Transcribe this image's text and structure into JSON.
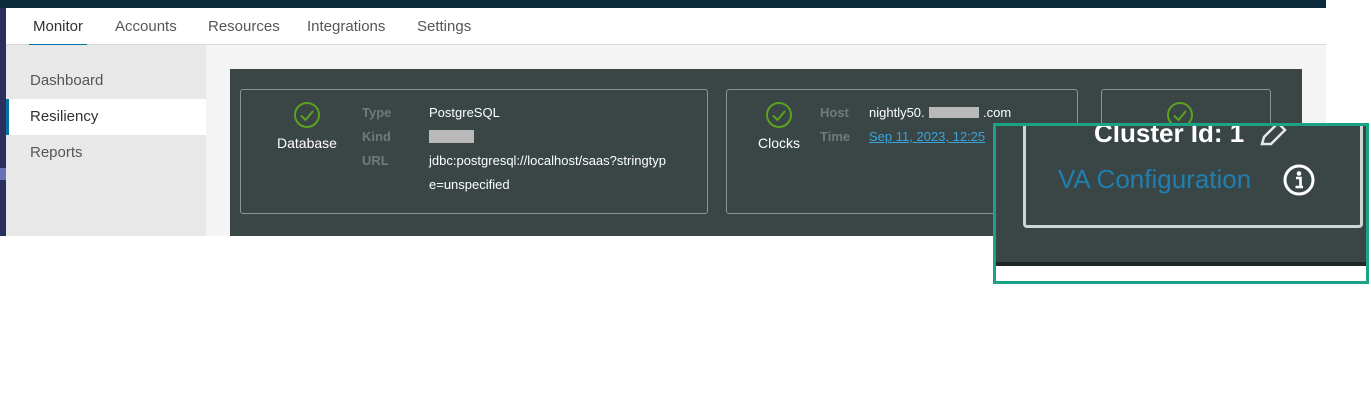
{
  "nav": {
    "tabs": [
      "Monitor",
      "Accounts",
      "Resources",
      "Integrations",
      "Settings"
    ],
    "active": "Monitor"
  },
  "sidebar": {
    "items": [
      "Dashboard",
      "Resiliency",
      "Reports"
    ],
    "active": "Resiliency"
  },
  "cards": {
    "database": {
      "name": "Database",
      "status_icon": "check-circle-icon",
      "type_label": "Type",
      "type_value": "PostgreSQL",
      "kind_label": "Kind",
      "kind_value_redacted": true,
      "url_label": "URL",
      "url_value_line1": "jdbc:postgresql://localhost/saas?stringtyp",
      "url_value_line2": "e=unspecified"
    },
    "clocks": {
      "name": "Clocks",
      "status_icon": "check-circle-icon",
      "host_label": "Host",
      "host_value_prefix": "nightly50.",
      "host_value_suffix": ".com",
      "time_label": "Time",
      "time_value": "Sep 11, 2023, 12:25"
    },
    "cluster": {
      "status_icon": "check-circle-icon"
    }
  },
  "zoom": {
    "cluster_text": "Cluster Id: 1",
    "link_text": "VA Configuration",
    "edit_icon": "pencil-icon",
    "info_icon": "info-circle-icon"
  },
  "colors": {
    "accent": "#0072a3",
    "panel": "#3a4545",
    "ok_green": "#5aa220",
    "highlight_border": "#1aa386",
    "link": "#3aa3d9"
  }
}
